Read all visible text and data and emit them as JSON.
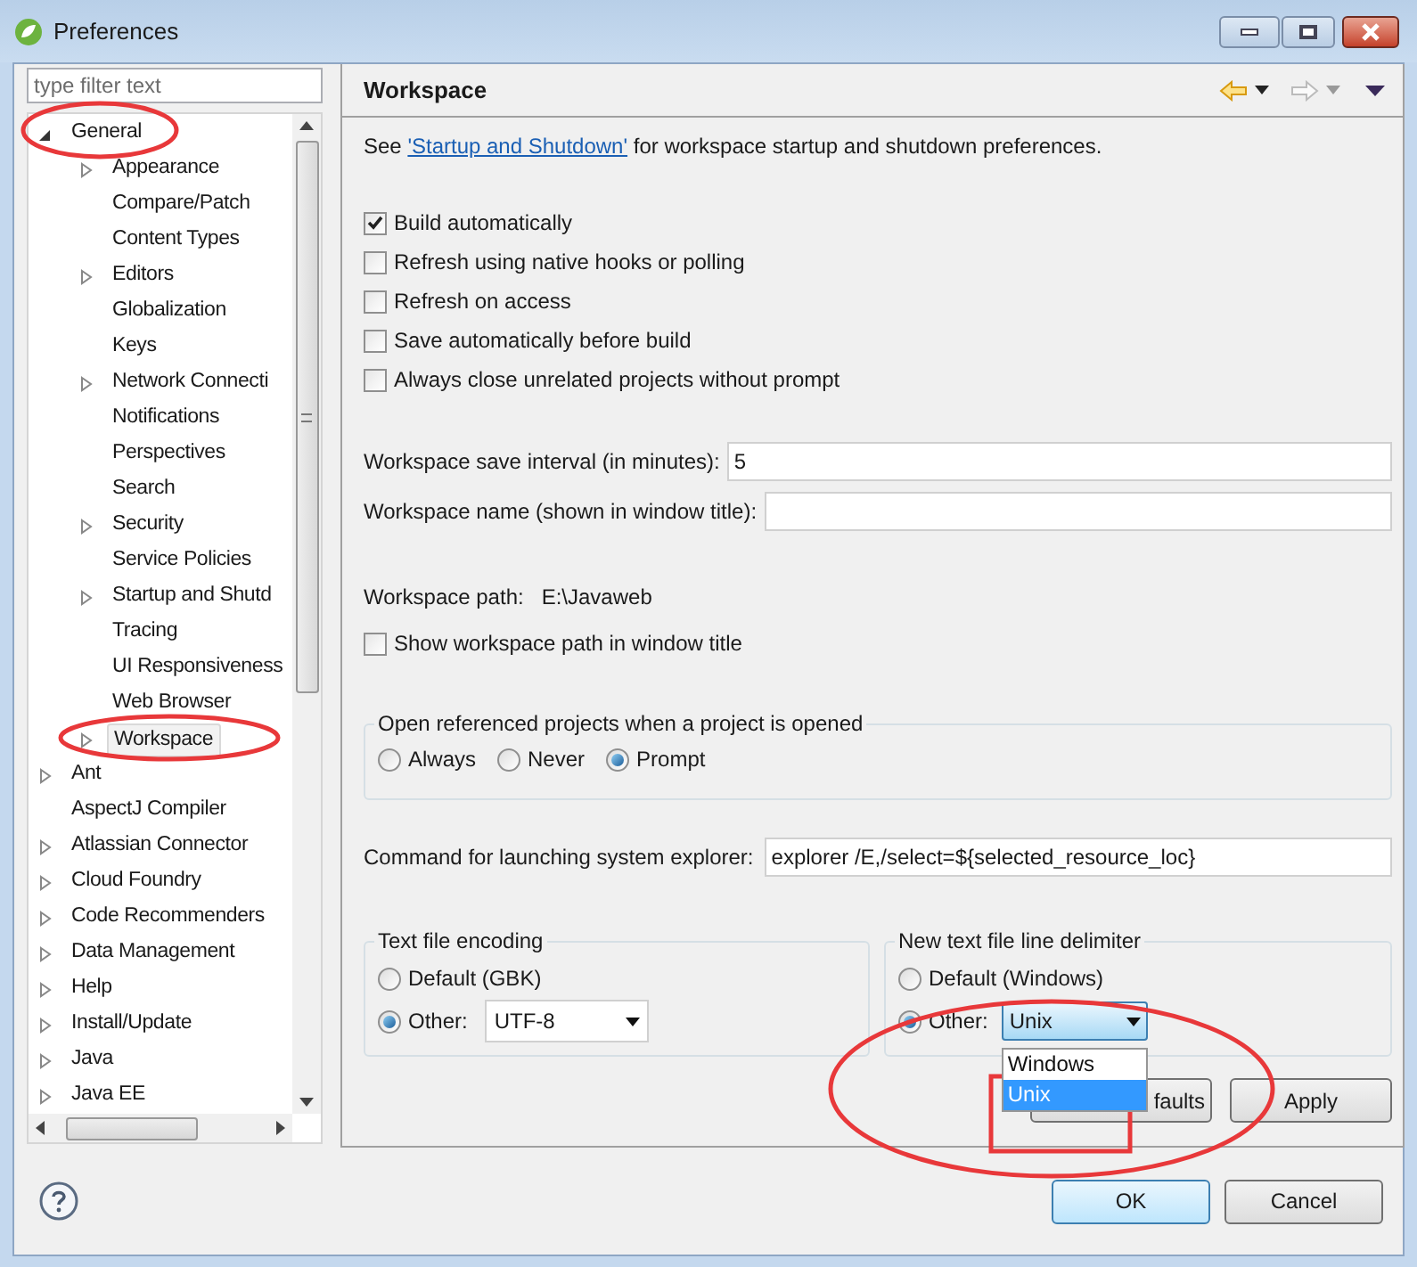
{
  "window": {
    "title": "Preferences"
  },
  "filter": {
    "placeholder": "type filter text"
  },
  "tree": [
    {
      "label": "General",
      "kind": "branch",
      "expanded": true,
      "selected": false,
      "children": [
        {
          "label": "Appearance",
          "kind": "branch",
          "expanded": false,
          "selected": false
        },
        {
          "label": "Compare/Patch",
          "kind": "leaf",
          "selected": false
        },
        {
          "label": "Content Types",
          "kind": "leaf",
          "selected": false
        },
        {
          "label": "Editors",
          "kind": "branch",
          "expanded": false,
          "selected": false
        },
        {
          "label": "Globalization",
          "kind": "leaf",
          "selected": false
        },
        {
          "label": "Keys",
          "kind": "leaf",
          "selected": false
        },
        {
          "label": "Network Connecti",
          "kind": "branch",
          "expanded": false,
          "selected": false
        },
        {
          "label": "Notifications",
          "kind": "leaf",
          "selected": false
        },
        {
          "label": "Perspectives",
          "kind": "leaf",
          "selected": false
        },
        {
          "label": "Search",
          "kind": "leaf",
          "selected": false
        },
        {
          "label": "Security",
          "kind": "branch",
          "expanded": false,
          "selected": false
        },
        {
          "label": "Service Policies",
          "kind": "leaf",
          "selected": false
        },
        {
          "label": "Startup and Shutd",
          "kind": "branch",
          "expanded": false,
          "selected": false
        },
        {
          "label": "Tracing",
          "kind": "leaf",
          "selected": false
        },
        {
          "label": "UI Responsiveness",
          "kind": "leaf",
          "selected": false
        },
        {
          "label": "Web Browser",
          "kind": "leaf",
          "selected": false
        },
        {
          "label": "Workspace",
          "kind": "branch",
          "expanded": false,
          "selected": true
        }
      ]
    },
    {
      "label": "Ant",
      "kind": "branch",
      "expanded": false,
      "selected": false
    },
    {
      "label": "AspectJ Compiler",
      "kind": "leaf",
      "selected": false
    },
    {
      "label": "Atlassian Connector",
      "kind": "branch",
      "expanded": false,
      "selected": false
    },
    {
      "label": "Cloud Foundry",
      "kind": "branch",
      "expanded": false,
      "selected": false
    },
    {
      "label": "Code Recommenders",
      "kind": "branch",
      "expanded": false,
      "selected": false
    },
    {
      "label": "Data Management",
      "kind": "branch",
      "expanded": false,
      "selected": false
    },
    {
      "label": "Help",
      "kind": "branch",
      "expanded": false,
      "selected": false
    },
    {
      "label": "Install/Update",
      "kind": "branch",
      "expanded": false,
      "selected": false
    },
    {
      "label": "Java",
      "kind": "branch",
      "expanded": false,
      "selected": false
    },
    {
      "label": "Java EE",
      "kind": "branch",
      "expanded": false,
      "selected": false
    }
  ],
  "page": {
    "title": "Workspace",
    "intro_before": "See ",
    "link": "'Startup and Shutdown'",
    "intro_after": " for workspace startup and shutdown preferences."
  },
  "checkboxes": [
    {
      "label": "Build automatically",
      "checked": true
    },
    {
      "label": "Refresh using native hooks or polling",
      "checked": false
    },
    {
      "label": "Refresh on access",
      "checked": false
    },
    {
      "label": "Save automatically before build",
      "checked": false
    },
    {
      "label": "Always close unrelated projects without prompt",
      "checked": false
    }
  ],
  "save_interval": {
    "label": "Workspace save interval (in minutes):",
    "value": "5"
  },
  "workspace_name": {
    "label": "Workspace name (shown in window title):"
  },
  "workspace_path": {
    "label": "Workspace path:",
    "value": "E:\\Javaweb"
  },
  "show_path": {
    "label": "Show workspace path in window title",
    "checked": false
  },
  "open_projects": {
    "title": "Open referenced projects when a project is opened",
    "options": [
      {
        "label": "Always",
        "selected": false
      },
      {
        "label": "Never",
        "selected": false
      },
      {
        "label": "Prompt",
        "selected": true
      }
    ]
  },
  "command": {
    "label": "Command for launching system explorer:",
    "value": "explorer /E,/select=${selected_resource_loc}"
  },
  "encoding": {
    "title": "Text file encoding",
    "options": [
      {
        "label": "Default (GBK)",
        "selected": false
      },
      {
        "label": "Other:",
        "selected": true
      }
    ],
    "value": "UTF-8"
  },
  "delimiter": {
    "title": "New text file line delimiter",
    "options": [
      {
        "label": "Default (Windows)",
        "selected": false
      },
      {
        "label": "Other:",
        "selected": true
      }
    ],
    "value": "Unix",
    "dropdown": [
      {
        "label": "Windows",
        "selected": false
      },
      {
        "label": "Unix",
        "selected": true
      }
    ]
  },
  "page_buttons": [
    "faults",
    "Apply"
  ],
  "dialog_buttons": [
    "OK",
    "Cancel"
  ]
}
